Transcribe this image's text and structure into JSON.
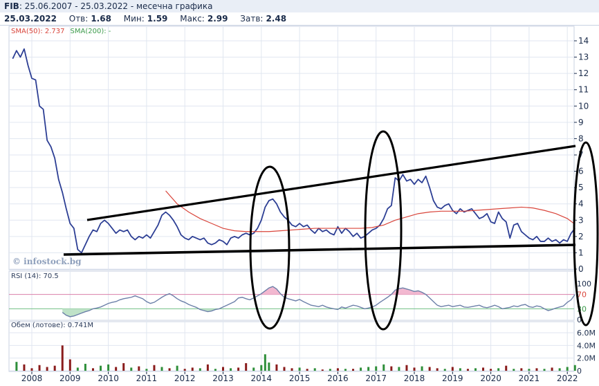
{
  "header": {
    "ticker": "FIB",
    "range": ": 25.06.2007 - 25.03.2022 - месечна графика",
    "date": "25.03.2022",
    "open_label": "Отв:",
    "open": "1.68",
    "low_label": "Мин:",
    "low": "1.59",
    "high_label": "Макс:",
    "high": "2.99",
    "close_label": "Затв:",
    "close": "2.48"
  },
  "sma": {
    "sma50": "SMA(50): 2.737",
    "sma200": "SMA(200): -"
  },
  "rsi_label": "RSI (14): 70.5",
  "volume_label": "Обем (лотове): 0.741M",
  "watermark": "© infostock.bg",
  "colors": {
    "price": "#2c3e94",
    "sma50": "#d9443a",
    "rsi": "#6b7fa8",
    "overbought_fill": "#f2b8d0",
    "oversold_fill": "#bfe2c8",
    "grid": "#c8d2e2",
    "volume_up": "#2f8f3a",
    "volume_down": "#8a1c1c",
    "annotation": "#000000"
  },
  "chart_data": [
    {
      "type": "line",
      "panel": "price",
      "x_unit": "year",
      "x_ticks": [
        "2008",
        "2009",
        "2010",
        "2011",
        "2012",
        "2013",
        "2014",
        "2015",
        "2016",
        "2017",
        "2018",
        "2019",
        "2020",
        "2021",
        "2022"
      ],
      "ylim": [
        0,
        14.5
      ],
      "y_ticks": [
        "0",
        "1",
        "2",
        "3",
        "4",
        "5",
        "6",
        "7",
        "8",
        "9",
        "10",
        "11",
        "12",
        "13",
        "14"
      ],
      "grid": true,
      "series": [
        {
          "role": "price",
          "x": [
            2007.5,
            2007.6,
            2007.7,
            2007.8,
            2007.9,
            2008.0,
            2008.1,
            2008.2,
            2008.3,
            2008.4,
            2008.5,
            2008.6,
            2008.7,
            2008.8,
            2008.9,
            2009.0,
            2009.1,
            2009.2,
            2009.3,
            2009.4,
            2009.5,
            2009.6,
            2009.7,
            2009.8,
            2009.9,
            2010.0,
            2010.1,
            2010.2,
            2010.3,
            2010.4,
            2010.5,
            2010.6,
            2010.7,
            2010.8,
            2010.9,
            2011.0,
            2011.1,
            2011.2,
            2011.3,
            2011.4,
            2011.5,
            2011.6,
            2011.7,
            2011.8,
            2011.9,
            2012.0,
            2012.1,
            2012.2,
            2012.3,
            2012.4,
            2012.5,
            2012.6,
            2012.7,
            2012.8,
            2012.9,
            2013.0,
            2013.1,
            2013.2,
            2013.3,
            2013.4,
            2013.5,
            2013.6,
            2013.7,
            2013.8,
            2013.9,
            2014.0,
            2014.1,
            2014.2,
            2014.3,
            2014.4,
            2014.5,
            2014.6,
            2014.7,
            2014.8,
            2014.9,
            2015.0,
            2015.1,
            2015.2,
            2015.3,
            2015.4,
            2015.5,
            2015.6,
            2015.7,
            2015.8,
            2015.9,
            2016.0,
            2016.1,
            2016.2,
            2016.3,
            2016.4,
            2016.5,
            2016.6,
            2016.7,
            2016.8,
            2016.9,
            2017.0,
            2017.1,
            2017.2,
            2017.3,
            2017.4,
            2017.5,
            2017.6,
            2017.7,
            2017.8,
            2017.9,
            2018.0,
            2018.1,
            2018.2,
            2018.3,
            2018.4,
            2018.5,
            2018.6,
            2018.7,
            2018.8,
            2018.9,
            2019.0,
            2019.1,
            2019.2,
            2019.3,
            2019.4,
            2019.5,
            2019.6,
            2019.7,
            2019.8,
            2019.9,
            2020.0,
            2020.1,
            2020.2,
            2020.3,
            2020.4,
            2020.5,
            2020.6,
            2020.7,
            2020.8,
            2020.9,
            2021.0,
            2021.1,
            2021.2,
            2021.3,
            2021.4,
            2021.5,
            2021.6,
            2021.7,
            2021.8,
            2021.9,
            2022.0,
            2022.1,
            2022.2
          ],
          "y": [
            12.9,
            13.4,
            13.0,
            13.5,
            12.5,
            11.7,
            11.6,
            10.0,
            9.8,
            7.9,
            7.5,
            6.8,
            5.5,
            4.7,
            3.7,
            2.8,
            2.5,
            1.2,
            1.0,
            1.5,
            2.0,
            2.4,
            2.3,
            2.8,
            3.0,
            2.8,
            2.5,
            2.2,
            2.4,
            2.3,
            2.4,
            2.0,
            1.8,
            2.0,
            1.9,
            2.1,
            1.9,
            2.3,
            2.7,
            3.3,
            3.5,
            3.3,
            3.0,
            2.6,
            2.1,
            1.9,
            1.8,
            2.0,
            1.9,
            1.8,
            1.9,
            1.6,
            1.5,
            1.6,
            1.8,
            1.7,
            1.5,
            1.9,
            2.0,
            1.9,
            2.1,
            2.2,
            2.1,
            2.2,
            2.5,
            3.0,
            3.8,
            4.2,
            4.3,
            4.0,
            3.5,
            3.2,
            3.0,
            2.7,
            2.6,
            2.8,
            2.6,
            2.7,
            2.4,
            2.2,
            2.5,
            2.3,
            2.4,
            2.2,
            2.1,
            2.6,
            2.2,
            2.5,
            2.3,
            2.0,
            2.2,
            1.9,
            2.0,
            2.2,
            2.4,
            2.5,
            2.7,
            3.1,
            3.7,
            3.9,
            5.6,
            5.4,
            5.8,
            5.4,
            5.5,
            5.2,
            5.5,
            5.3,
            5.7,
            5.0,
            4.2,
            3.8,
            3.7,
            3.9,
            4.0,
            3.6,
            3.4,
            3.7,
            3.5,
            3.6,
            3.7,
            3.4,
            3.1,
            3.2,
            3.4,
            2.9,
            2.8,
            3.5,
            3.1,
            2.9,
            1.9,
            2.7,
            2.8,
            2.3,
            2.1,
            1.9,
            1.8,
            2.0,
            1.7,
            1.7,
            1.9,
            1.7,
            1.8,
            1.6,
            1.8,
            1.7,
            2.2,
            2.5
          ]
        },
        {
          "role": "sma50",
          "x": [
            2011.5,
            2011.8,
            2012.1,
            2012.4,
            2012.7,
            2013.0,
            2013.3,
            2013.6,
            2013.9,
            2014.2,
            2014.5,
            2014.8,
            2015.1,
            2015.4,
            2015.7,
            2016.0,
            2016.3,
            2016.6,
            2016.9,
            2017.2,
            2017.5,
            2017.8,
            2018.1,
            2018.4,
            2018.7,
            2019.0,
            2019.3,
            2019.6,
            2019.9,
            2020.2,
            2020.5,
            2020.8,
            2021.1,
            2021.4,
            2021.7,
            2022.0,
            2022.2
          ],
          "y": [
            4.8,
            4.0,
            3.5,
            3.1,
            2.8,
            2.5,
            2.35,
            2.3,
            2.3,
            2.3,
            2.35,
            2.4,
            2.45,
            2.5,
            2.5,
            2.5,
            2.5,
            2.5,
            2.55,
            2.7,
            3.0,
            3.2,
            3.4,
            3.5,
            3.55,
            3.55,
            3.55,
            3.6,
            3.65,
            3.7,
            3.75,
            3.8,
            3.75,
            3.6,
            3.4,
            3.1,
            2.75
          ]
        }
      ]
    },
    {
      "type": "line",
      "panel": "rsi",
      "ylim": [
        0,
        100
      ],
      "y_ticks": [
        "0",
        "30",
        "70",
        "100"
      ],
      "x": [
        2008.8,
        2008.9,
        2009.0,
        2009.1,
        2009.2,
        2009.3,
        2009.4,
        2009.5,
        2009.6,
        2009.7,
        2009.8,
        2009.9,
        2010.0,
        2010.1,
        2010.2,
        2010.3,
        2010.4,
        2010.5,
        2010.6,
        2010.7,
        2010.8,
        2010.9,
        2011.0,
        2011.1,
        2011.2,
        2011.3,
        2011.4,
        2011.5,
        2011.6,
        2011.7,
        2011.8,
        2011.9,
        2012.0,
        2012.1,
        2012.2,
        2012.3,
        2012.4,
        2012.5,
        2012.6,
        2012.7,
        2012.8,
        2012.9,
        2013.0,
        2013.1,
        2013.2,
        2013.3,
        2013.4,
        2013.5,
        2013.6,
        2013.7,
        2013.8,
        2013.9,
        2014.0,
        2014.1,
        2014.2,
        2014.3,
        2014.4,
        2014.5,
        2014.6,
        2014.7,
        2014.8,
        2014.9,
        2015.0,
        2015.1,
        2015.2,
        2015.3,
        2015.4,
        2015.5,
        2015.6,
        2015.7,
        2015.8,
        2015.9,
        2016.0,
        2016.1,
        2016.2,
        2016.3,
        2016.4,
        2016.5,
        2016.6,
        2016.7,
        2016.8,
        2016.9,
        2017.0,
        2017.1,
        2017.2,
        2017.3,
        2017.4,
        2017.5,
        2017.6,
        2017.7,
        2017.8,
        2017.9,
        2018.0,
        2018.1,
        2018.2,
        2018.3,
        2018.4,
        2018.5,
        2018.6,
        2018.7,
        2018.8,
        2018.9,
        2019.0,
        2019.1,
        2019.2,
        2019.3,
        2019.4,
        2019.5,
        2019.6,
        2019.7,
        2019.8,
        2019.9,
        2020.0,
        2020.1,
        2020.2,
        2020.3,
        2020.4,
        2020.5,
        2020.6,
        2020.7,
        2020.8,
        2020.9,
        2021.0,
        2021.1,
        2021.2,
        2021.3,
        2021.4,
        2021.5,
        2021.6,
        2021.7,
        2021.8,
        2021.9,
        2022.0,
        2022.1,
        2022.2
      ],
      "y": [
        20,
        12,
        8,
        10,
        14,
        18,
        22,
        25,
        30,
        32,
        35,
        40,
        45,
        48,
        50,
        55,
        58,
        60,
        62,
        66,
        62,
        58,
        50,
        45,
        48,
        55,
        62,
        68,
        72,
        66,
        58,
        52,
        48,
        42,
        38,
        34,
        28,
        25,
        22,
        24,
        28,
        30,
        35,
        40,
        45,
        50,
        60,
        62,
        58,
        55,
        60,
        66,
        72,
        80,
        88,
        92,
        85,
        72,
        62,
        58,
        55,
        52,
        56,
        50,
        45,
        40,
        38,
        36,
        40,
        35,
        32,
        30,
        28,
        35,
        32,
        36,
        40,
        38,
        34,
        30,
        32,
        35,
        40,
        48,
        55,
        62,
        70,
        82,
        86,
        88,
        85,
        82,
        78,
        80,
        76,
        70,
        60,
        50,
        40,
        36,
        38,
        40,
        36,
        38,
        40,
        35,
        34,
        36,
        38,
        40,
        35,
        33,
        36,
        40,
        36,
        30,
        32,
        34,
        38,
        36,
        40,
        42,
        36,
        34,
        38,
        36,
        30,
        25,
        28,
        32,
        35,
        38,
        48,
        55,
        70
      ]
    },
    {
      "type": "bar",
      "panel": "volume",
      "ylim": [
        0,
        6
      ],
      "y_ticks": [
        "0",
        "2.0M",
        "4.0M",
        "6.0M"
      ],
      "x": [
        2007.6,
        2007.8,
        2008.0,
        2008.2,
        2008.4,
        2008.6,
        2008.8,
        2009.0,
        2009.2,
        2009.4,
        2009.6,
        2009.8,
        2010.0,
        2010.2,
        2010.4,
        2010.6,
        2010.8,
        2011.0,
        2011.2,
        2011.4,
        2011.6,
        2011.8,
        2012.0,
        2012.2,
        2012.4,
        2012.6,
        2012.8,
        2013.0,
        2013.2,
        2013.4,
        2013.6,
        2013.8,
        2014.0,
        2014.1,
        2014.2,
        2014.4,
        2014.6,
        2014.8,
        2015.0,
        2015.2,
        2015.4,
        2015.6,
        2015.8,
        2016.0,
        2016.2,
        2016.4,
        2016.6,
        2016.8,
        2017.0,
        2017.2,
        2017.4,
        2017.6,
        2017.8,
        2018.0,
        2018.2,
        2018.4,
        2018.6,
        2018.8,
        2019.0,
        2019.2,
        2019.4,
        2019.6,
        2019.8,
        2020.0,
        2020.2,
        2020.4,
        2020.6,
        2020.8,
        2021.0,
        2021.2,
        2021.4,
        2021.6,
        2021.8,
        2022.0,
        2022.2
      ],
      "values": [
        1.4,
        1.0,
        0.4,
        0.9,
        0.6,
        0.8,
        4.0,
        1.8,
        0.5,
        1.1,
        0.4,
        0.8,
        1.0,
        0.6,
        1.2,
        0.5,
        0.7,
        0.3,
        0.9,
        0.6,
        0.4,
        0.8,
        0.3,
        0.5,
        0.4,
        1.0,
        0.3,
        0.6,
        0.4,
        0.5,
        1.2,
        0.5,
        0.9,
        2.6,
        1.3,
        1.0,
        0.6,
        0.4,
        0.5,
        0.3,
        0.4,
        0.2,
        0.3,
        0.4,
        0.3,
        0.3,
        0.5,
        0.6,
        0.7,
        1.0,
        0.7,
        0.6,
        0.9,
        0.5,
        0.7,
        0.6,
        0.4,
        0.3,
        0.6,
        0.4,
        0.3,
        0.4,
        0.5,
        0.3,
        0.4,
        0.8,
        0.3,
        0.4,
        0.3,
        0.4,
        0.3,
        0.5,
        0.4,
        0.6,
        0.9
      ],
      "up": [
        true,
        false,
        false,
        false,
        false,
        false,
        false,
        false,
        true,
        true,
        false,
        true,
        true,
        false,
        false,
        true,
        false,
        true,
        false,
        true,
        false,
        true,
        false,
        false,
        true,
        false,
        true,
        false,
        true,
        false,
        false,
        true,
        true,
        true,
        true,
        false,
        false,
        false,
        true,
        false,
        true,
        false,
        true,
        false,
        true,
        false,
        true,
        true,
        true,
        true,
        false,
        true,
        false,
        false,
        true,
        false,
        false,
        true,
        false,
        true,
        false,
        true,
        false,
        false,
        true,
        false,
        true,
        false,
        true,
        false,
        true,
        false,
        true,
        true,
        true
      ]
    }
  ]
}
